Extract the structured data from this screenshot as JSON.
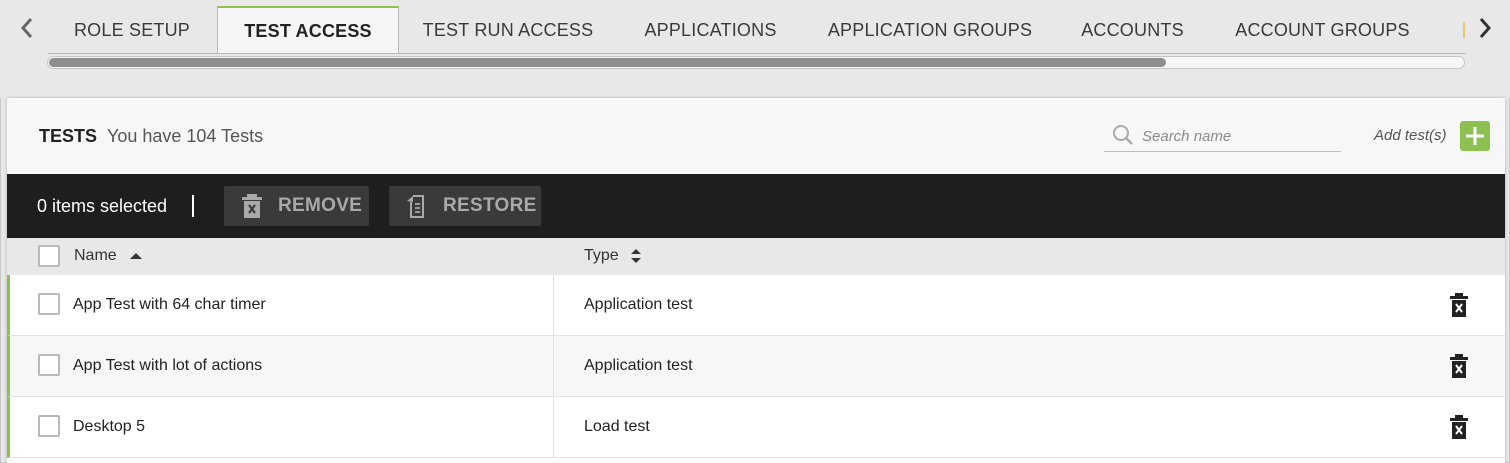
{
  "tabs": [
    {
      "label": "ROLE SETUP",
      "active": false
    },
    {
      "label": "TEST ACCESS",
      "active": true
    },
    {
      "label": "TEST RUN ACCESS",
      "active": false
    },
    {
      "label": "APPLICATIONS",
      "active": false
    },
    {
      "label": "APPLICATION GROUPS",
      "active": false
    },
    {
      "label": "ACCOUNTS",
      "active": false
    },
    {
      "label": "ACCOUNT GROUPS",
      "active": false
    }
  ],
  "tab_scroll_fraction": 0.79,
  "icons": {
    "prev": "chevron-left-icon",
    "next": "chevron-right-icon",
    "search": "search-icon",
    "add": "plus-icon",
    "remove": "trash-x-icon",
    "restore": "restore-icon",
    "row_delete": "trash-x-icon"
  },
  "colors": {
    "accent": "#8cc152",
    "action_bar": "#1e1e1e",
    "header_bg": "#f7f7f7"
  },
  "panel": {
    "title": "TESTS",
    "subtitle": "You have 104 Tests",
    "search_placeholder": "Search name",
    "search_value": "",
    "add_label": "Add test(s)"
  },
  "actionbar": {
    "selected_text": "0 items selected",
    "remove_label": "REMOVE",
    "restore_label": "RESTORE"
  },
  "table": {
    "columns": {
      "name": "Name",
      "type": "Type"
    },
    "name_sort": "ascending",
    "rows": [
      {
        "name": "App Test with 64 char timer",
        "type": "Application test"
      },
      {
        "name": "App Test with lot of actions",
        "type": "Application test"
      },
      {
        "name": "Desktop 5",
        "type": "Load test"
      }
    ]
  }
}
